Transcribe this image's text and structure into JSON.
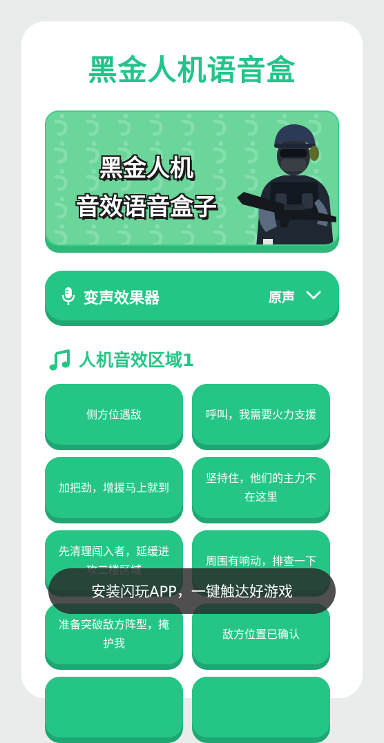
{
  "app": {
    "title": "黑金人机语音盒"
  },
  "banner": {
    "line1": "黑金人机",
    "line2": "音效语音盒子"
  },
  "voice_changer": {
    "label": "变声效果器",
    "value": "原声"
  },
  "section": {
    "title": "人机音效区域1"
  },
  "sounds": [
    "侧方位遇敌",
    "呼叫，我需要火力支援",
    "加把劲，增援马上就到",
    "坚持住，他们的主力不在这里",
    "先清理闯入者，延缓进攻二楼区域",
    "周围有响动，排查一下",
    "准备突破敌方阵型，掩护我",
    "敌方位置已确认",
    "",
    ""
  ],
  "toast": {
    "text": "安装闪玩APP，一键触达好游戏"
  },
  "colors": {
    "primary": "#25c586",
    "primary_dark": "#1da973",
    "banner_bg": "#6bd59a"
  },
  "icons": {
    "mic": "microphone-icon",
    "chevron": "chevron-down-icon",
    "note": "music-note-icon"
  }
}
